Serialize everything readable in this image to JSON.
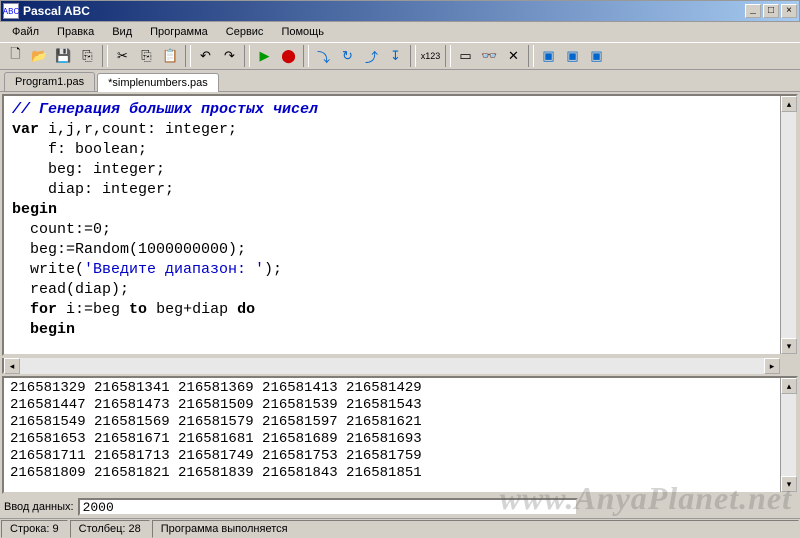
{
  "window": {
    "title": "Pascal ABC"
  },
  "menu": {
    "items": [
      "Файл",
      "Правка",
      "Вид",
      "Программа",
      "Сервис",
      "Помощь"
    ]
  },
  "tabs": [
    {
      "label": "Program1.pas",
      "active": false
    },
    {
      "label": "*simplenumbers.pas",
      "active": true
    }
  ],
  "code": {
    "l1_comment": "// Генерация больших простых чисел",
    "l2_kw_var": "var",
    "l2_rest": " i,j,r,count: integer;",
    "l3": "    f: boolean;",
    "l4": "    beg: integer;",
    "l5": "    diap: integer;",
    "l6_begin": "begin",
    "l7": "  count:=0;",
    "l8": "  beg:=Random(1000000000);",
    "l9a": "  write(",
    "l9_str": "'Введите диапазон: '",
    "l9b": ");",
    "l10": "  read(diap);",
    "l11a": "  ",
    "l11_for": "for",
    "l11b": " i:=beg ",
    "l11_to": "to",
    "l11c": " beg+diap ",
    "l11_do": "do",
    "l12_begin": "  begin"
  },
  "output_lines": [
    "216581329 216581341 216581369 216581413 216581429",
    "216581447 216581473 216581509 216581539 216581543",
    "216581549 216581569 216581579 216581597 216581621",
    "216581653 216581671 216581681 216581689 216581693",
    "216581711 216581713 216581749 216581753 216581759",
    "216581809 216581821 216581839 216581843 216581851"
  ],
  "input": {
    "label": "Ввод данных:",
    "value": "2000"
  },
  "status": {
    "line": "Строка: 9",
    "col": "Столбец: 28",
    "msg": "Программа выполняется"
  },
  "watermark": "www.AnyaPlanet.net"
}
